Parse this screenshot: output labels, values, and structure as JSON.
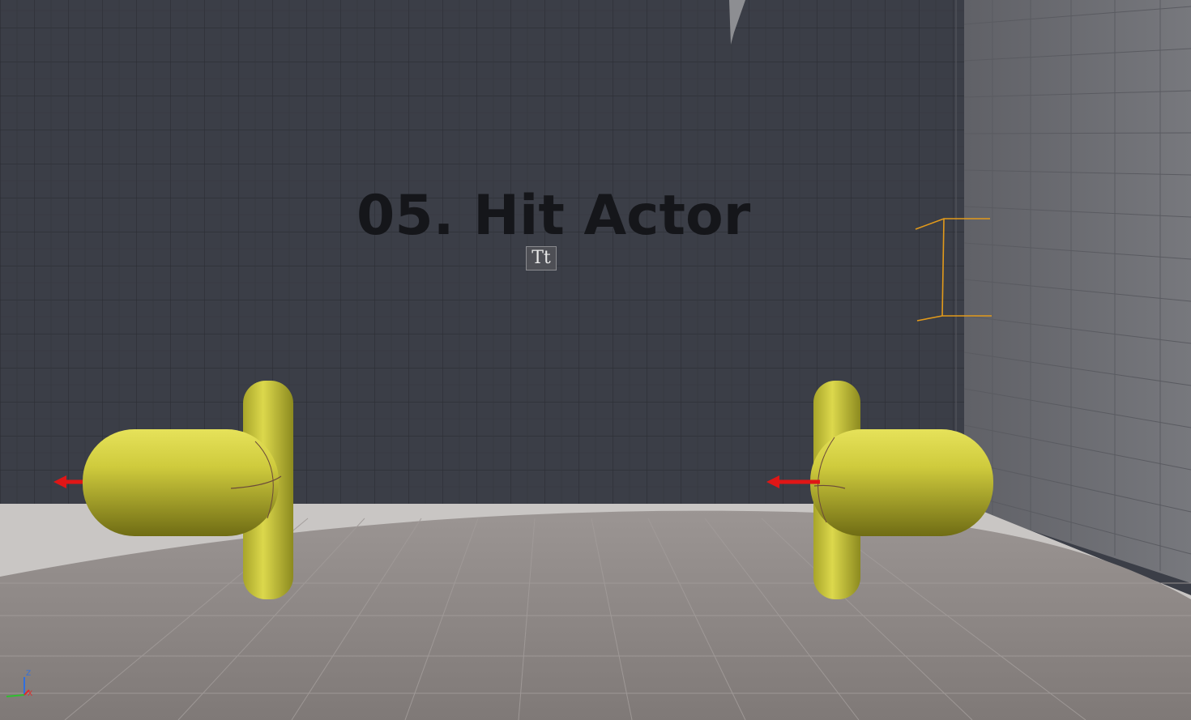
{
  "viewport": {
    "title_text": "05. Hit Actor",
    "text_render_icon_glyph": "Tt",
    "axis_gizmo": {
      "z_label": "Z",
      "x_label": "X"
    }
  },
  "colors": {
    "back_wall": "#3b3e47",
    "side_wall": "#6f7075",
    "floor": "#8a8482",
    "capsule_yellow": "#c9c63b",
    "arrow_red": "#e01616",
    "bounds_orange": "#e29a1b",
    "title_text": "#15161a"
  },
  "icons": [
    "text-render-icon",
    "arrow-component-icon",
    "axis-gizmo-icon"
  ]
}
